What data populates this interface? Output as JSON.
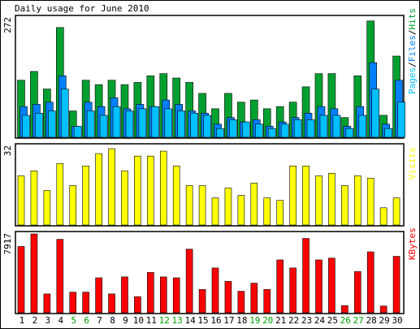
{
  "title": "Daily usage for June 2010",
  "colors": {
    "pages": "#00c0ff",
    "files": "#0080ff",
    "hits": "#00a030",
    "visits": "#ffff00",
    "kbytes": "#ff0000",
    "weekend_label": "#00a000",
    "weekday_label": "#000000"
  },
  "weekend_days": [
    "5",
    "6",
    "12",
    "13",
    "19",
    "20",
    "26",
    "27"
  ],
  "chart_data": [
    {
      "type": "bar",
      "ymax_label": "272",
      "legend": [
        "Pages",
        "Files",
        "Hits"
      ],
      "categories": [
        "1",
        "2",
        "3",
        "4",
        "5",
        "6",
        "7",
        "8",
        "9",
        "10",
        "11",
        "12",
        "13",
        "14",
        "15",
        "16",
        "17",
        "18",
        "19",
        "20",
        "21",
        "22",
        "23",
        "24",
        "25",
        "26",
        "27",
        "28",
        "29",
        "30"
      ],
      "series": [
        {
          "name": "Hits",
          "values": [
            130,
            150,
            110,
            250,
            60,
            130,
            120,
            130,
            120,
            125,
            140,
            145,
            135,
            125,
            100,
            65,
            100,
            80,
            85,
            65,
            70,
            80,
            115,
            145,
            145,
            45,
            140,
            265,
            50,
            185
          ]
        },
        {
          "name": "Files",
          "values": [
            70,
            75,
            80,
            140,
            25,
            80,
            70,
            90,
            65,
            75,
            70,
            85,
            75,
            60,
            55,
            30,
            45,
            35,
            40,
            25,
            35,
            45,
            55,
            70,
            65,
            25,
            70,
            170,
            30,
            130
          ]
        },
        {
          "name": "Pages",
          "values": [
            50,
            55,
            60,
            110,
            25,
            60,
            50,
            70,
            60,
            65,
            70,
            65,
            60,
            55,
            50,
            20,
            40,
            35,
            30,
            20,
            30,
            40,
            40,
            50,
            50,
            20,
            50,
            110,
            20,
            80
          ]
        }
      ]
    },
    {
      "type": "bar",
      "ymax_label": "32",
      "legend": [
        "Visits"
      ],
      "categories": [
        "1",
        "2",
        "3",
        "4",
        "5",
        "6",
        "7",
        "8",
        "9",
        "10",
        "11",
        "12",
        "13",
        "14",
        "15",
        "16",
        "17",
        "18",
        "19",
        "20",
        "21",
        "22",
        "23",
        "24",
        "25",
        "26",
        "27",
        "28",
        "29",
        "30"
      ],
      "series": [
        {
          "name": "Visits",
          "values": [
            20,
            22,
            14,
            25,
            16,
            24,
            29,
            31,
            22,
            28,
            28,
            30,
            24,
            16,
            16,
            11,
            15,
            12,
            17,
            11,
            10,
            24,
            24,
            20,
            21,
            16,
            20,
            19,
            7,
            11
          ]
        }
      ]
    },
    {
      "type": "bar",
      "ymax_label": "7917",
      "legend": [
        "KBytes"
      ],
      "categories": [
        "1",
        "2",
        "3",
        "4",
        "5",
        "6",
        "7",
        "8",
        "9",
        "10",
        "11",
        "12",
        "13",
        "14",
        "15",
        "16",
        "17",
        "18",
        "19",
        "20",
        "21",
        "22",
        "23",
        "24",
        "25",
        "26",
        "27",
        "28",
        "29",
        "30"
      ],
      "series": [
        {
          "name": "KBytes",
          "values": [
            7400,
            8800,
            2100,
            8200,
            2300,
            2300,
            3900,
            2100,
            4000,
            1800,
            4500,
            4000,
            3900,
            7100,
            2600,
            5000,
            3500,
            2400,
            3300,
            2600,
            5900,
            5000,
            8300,
            5900,
            6100,
            800,
            4600,
            6800,
            750,
            6300
          ]
        }
      ]
    }
  ]
}
